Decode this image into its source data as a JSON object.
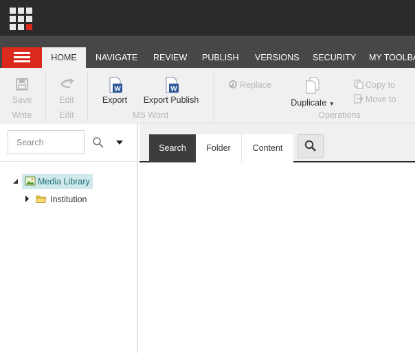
{
  "colors": {
    "topbar": "#2b2b2b",
    "tabbar": "#474747",
    "accent": "#dc291e",
    "selected_bg": "#cfe9ec"
  },
  "topbar": {
    "app_icon": "app-grid-icon"
  },
  "tabs": [
    {
      "label": "HOME",
      "active": true
    },
    {
      "label": "NAVIGATE"
    },
    {
      "label": "REVIEW"
    },
    {
      "label": "PUBLISH"
    },
    {
      "label": "VERSIONS"
    },
    {
      "label": "SECURITY"
    },
    {
      "label": "MY TOOLBA"
    }
  ],
  "ribbon": {
    "write": {
      "save": "Save",
      "group": "Write"
    },
    "edit": {
      "edit": "Edit",
      "group": "Edit"
    },
    "msword": {
      "export": "Export",
      "export_publish": "Export Publish",
      "group": "MS Word"
    },
    "operations": {
      "replace": "Replace",
      "duplicate": "Duplicate",
      "copy_to": "Copy to",
      "move_to": "Move to",
      "group": "Operations"
    }
  },
  "left": {
    "search_placeholder": "Search",
    "tree": [
      {
        "label": "Media Library",
        "selected": true,
        "expanded": true
      },
      {
        "label": "Institution",
        "expanded": false
      }
    ]
  },
  "main": {
    "tabs": [
      {
        "label": "Search",
        "active": true
      },
      {
        "label": "Folder"
      },
      {
        "label": "Content"
      }
    ]
  }
}
